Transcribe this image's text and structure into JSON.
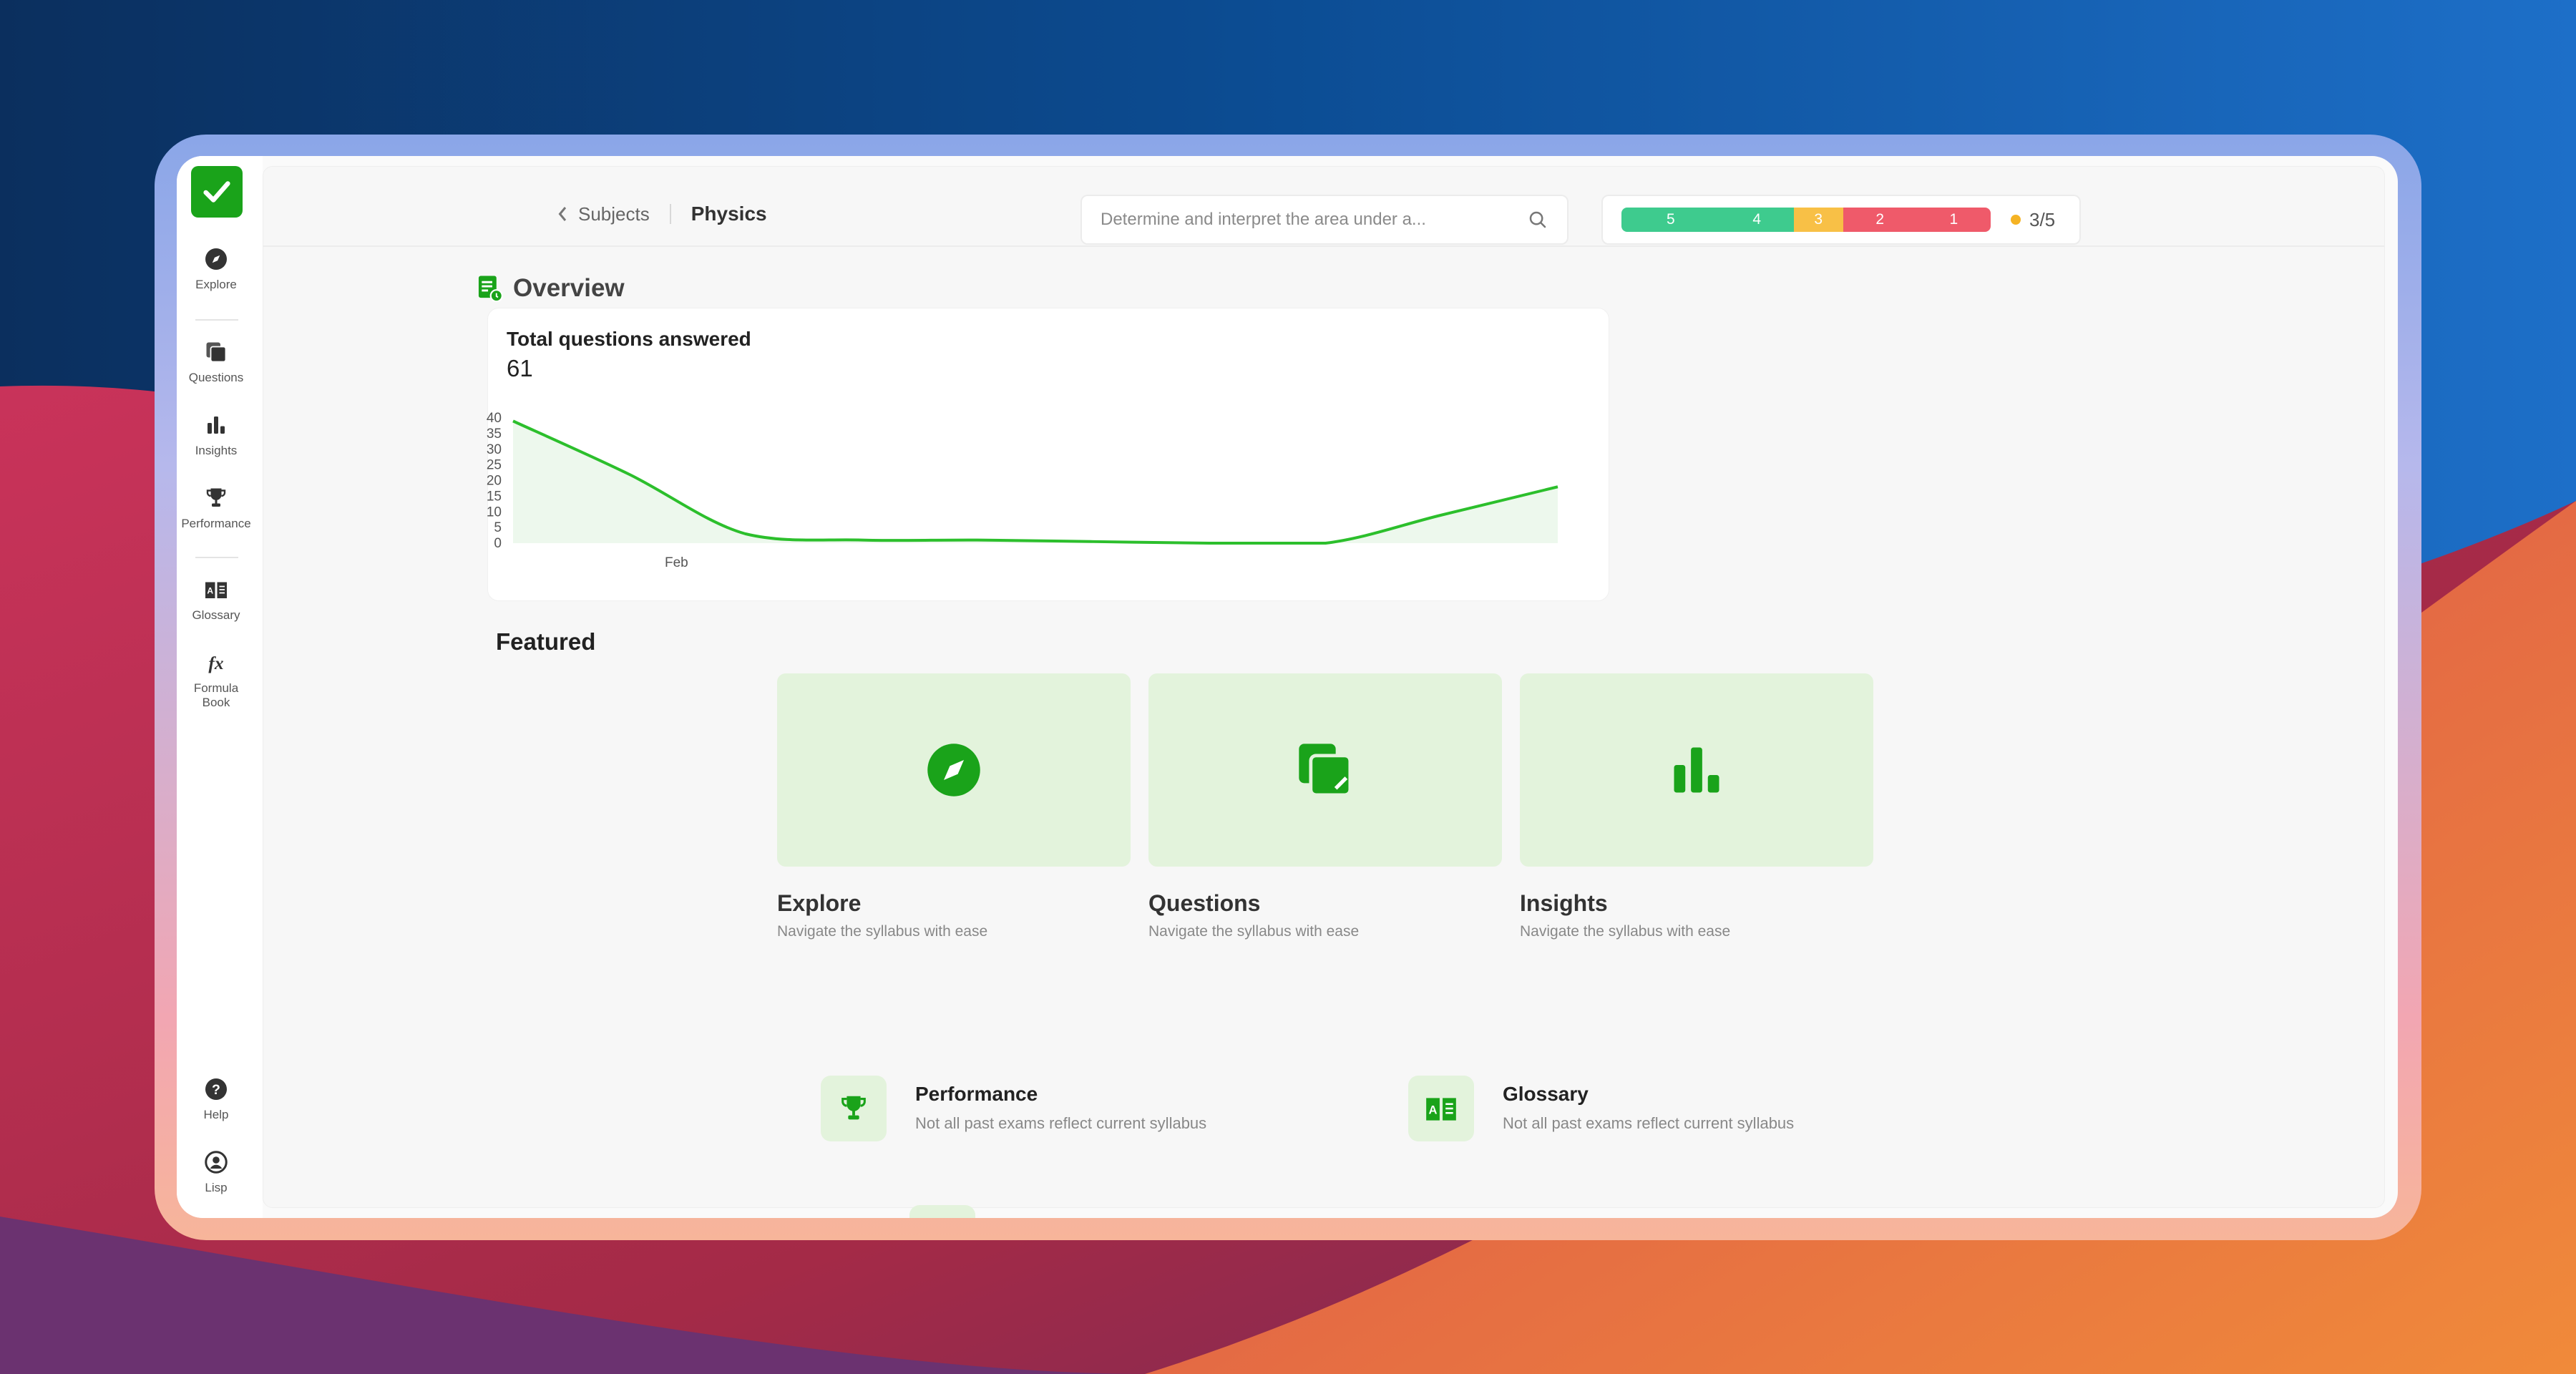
{
  "colors": {
    "brand_green": "#1aa31a",
    "feature_bg": "#e3f3dc",
    "rating_5": "#3ecb8e",
    "rating_4": "#3ecb8e",
    "rating_3": "#f8c046",
    "rating_2": "#ef5a6a",
    "rating_1": "#ef5a6a"
  },
  "sidebar": {
    "logo_icon": "checkmark-icon",
    "items": [
      {
        "label": "Explore",
        "icon": "compass-icon"
      },
      {
        "label": "Questions",
        "icon": "cards-icon"
      },
      {
        "label": "Insights",
        "icon": "bar-chart-icon"
      },
      {
        "label": "Performance",
        "icon": "trophy-icon"
      },
      {
        "label": "Glossary",
        "icon": "book-icon"
      },
      {
        "label": "Formula\nBook",
        "icon": "fx-icon"
      }
    ],
    "bottom": [
      {
        "label": "Help",
        "icon": "help-icon"
      },
      {
        "label": "Lisp",
        "icon": "user-icon"
      }
    ]
  },
  "header": {
    "back_label": "Subjects",
    "current": "Physics",
    "search_placeholder": "Determine and interpret the area under a...",
    "rating": {
      "segments": [
        {
          "label": "5",
          "share": 0.28
        },
        {
          "label": "4",
          "share": 0.21
        },
        {
          "label": "3",
          "share": 0.14
        },
        {
          "label": "2",
          "share": 0.21
        },
        {
          "label": "1",
          "share": 0.21
        }
      ],
      "score": "3/5"
    }
  },
  "overview": {
    "title": "Overview",
    "card_title": "Total questions answered",
    "total": "61"
  },
  "chart_data": {
    "type": "area",
    "x": [
      0,
      1,
      2,
      3,
      4,
      5,
      6,
      7,
      8,
      9
    ],
    "x_tick_label": "Feb",
    "values": [
      39,
      22,
      3,
      1,
      1,
      0.5,
      0,
      0,
      9,
      18
    ],
    "ylim": [
      0,
      40
    ],
    "yticks": [
      "0",
      "5",
      "10",
      "15",
      "20",
      "25",
      "30",
      "35",
      "40"
    ],
    "grid": false
  },
  "featured": {
    "title": "Featured",
    "cards": [
      {
        "name": "Explore",
        "desc": "Navigate the syllabus with ease",
        "icon": "compass-icon"
      },
      {
        "name": "Questions",
        "desc": "Navigate the syllabus with ease",
        "icon": "cards-icon"
      },
      {
        "name": "Insights",
        "desc": "Navigate the syllabus with ease",
        "icon": "bar-chart-icon"
      }
    ]
  },
  "tiles": [
    {
      "name": "Performance",
      "desc": "Not all past exams reflect current syllabus",
      "icon": "trophy-icon"
    },
    {
      "name": "Glossary",
      "desc": "Not all past exams reflect current syllabus",
      "icon": "book-icon"
    }
  ]
}
